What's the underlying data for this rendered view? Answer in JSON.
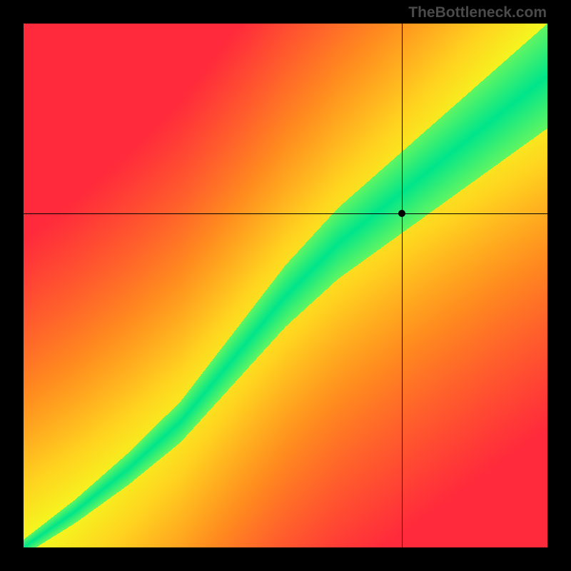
{
  "watermark": "TheBottleneck.com",
  "chart_data": {
    "type": "heatmap",
    "title": "",
    "xlabel": "",
    "ylabel": "",
    "xlim": [
      0,
      1
    ],
    "ylim": [
      0,
      1
    ],
    "grid": false,
    "legend": false,
    "crosshair": {
      "x": 0.722,
      "y": 0.638
    },
    "marker": {
      "x": 0.722,
      "y": 0.638
    },
    "color_stops": [
      {
        "value": 0.0,
        "color": "#ff2a3b"
      },
      {
        "value": 0.35,
        "color": "#ff8a1f"
      },
      {
        "value": 0.6,
        "color": "#ffd21f"
      },
      {
        "value": 0.8,
        "color": "#f2ff1f"
      },
      {
        "value": 0.92,
        "color": "#9bff4a"
      },
      {
        "value": 1.0,
        "color": "#00e58a"
      }
    ],
    "band": {
      "description": "Diagonal optimal band; center curve runs from (0,0) with slight S-curve to (1,1). Green inside band, grading through yellow/orange to red with distance.",
      "center_points": [
        {
          "x": 0.0,
          "y": 0.0
        },
        {
          "x": 0.1,
          "y": 0.07
        },
        {
          "x": 0.2,
          "y": 0.15
        },
        {
          "x": 0.3,
          "y": 0.24
        },
        {
          "x": 0.4,
          "y": 0.36
        },
        {
          "x": 0.5,
          "y": 0.48
        },
        {
          "x": 0.6,
          "y": 0.58
        },
        {
          "x": 0.7,
          "y": 0.66
        },
        {
          "x": 0.8,
          "y": 0.74
        },
        {
          "x": 0.9,
          "y": 0.82
        },
        {
          "x": 1.0,
          "y": 0.9
        }
      ],
      "half_width_start": 0.015,
      "half_width_end": 0.1
    }
  }
}
